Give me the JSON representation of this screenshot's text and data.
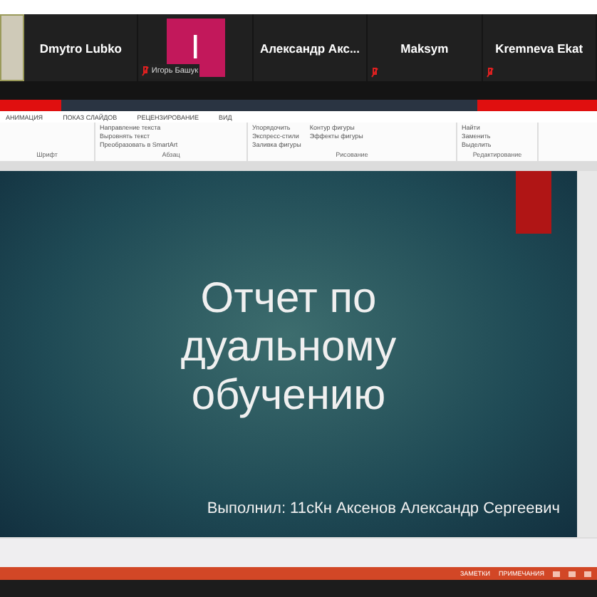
{
  "participants": [
    {
      "kind": "video"
    },
    {
      "kind": "name",
      "name": "Dmytro Lubko",
      "muted": false
    },
    {
      "kind": "avatar",
      "initial": "I",
      "name": "Игорь Башук",
      "muted": true
    },
    {
      "kind": "name",
      "name": "Александр  Акс...",
      "muted": false
    },
    {
      "kind": "name",
      "name": "Maksym",
      "muted": true
    },
    {
      "kind": "name",
      "name": "Kremneva  Ekat",
      "muted": true
    }
  ],
  "ribbon": {
    "tabs": [
      "АНИМАЦИЯ",
      "ПОКАЗ СЛАЙДОВ",
      "РЕЦЕНЗИРОВАНИЕ",
      "ВИД"
    ],
    "groups": [
      {
        "label": "Шрифт"
      },
      {
        "label": "Абзац",
        "items": [
          "Направление текста",
          "Выровнять текст",
          "Преобразовать в SmartArt"
        ]
      },
      {
        "label": "Рисование",
        "items": [
          "Упорядочить",
          "Экспресс-стили",
          "Заливка фигуры",
          "Контур фигуры",
          "Эффекты фигуры"
        ]
      },
      {
        "label": "Редактирование",
        "items": [
          "Найти",
          "Заменить",
          "Выделить"
        ]
      }
    ]
  },
  "slide": {
    "title_lines": [
      "Отчет по",
      "дуальному",
      "обучению"
    ],
    "subtitle": "Выполнил: 11сКн Аксенов Александр Сергеевич"
  },
  "status_bar": {
    "items": [
      "ЗАМЕТКИ",
      "ПРИМЕЧАНИЯ"
    ]
  }
}
